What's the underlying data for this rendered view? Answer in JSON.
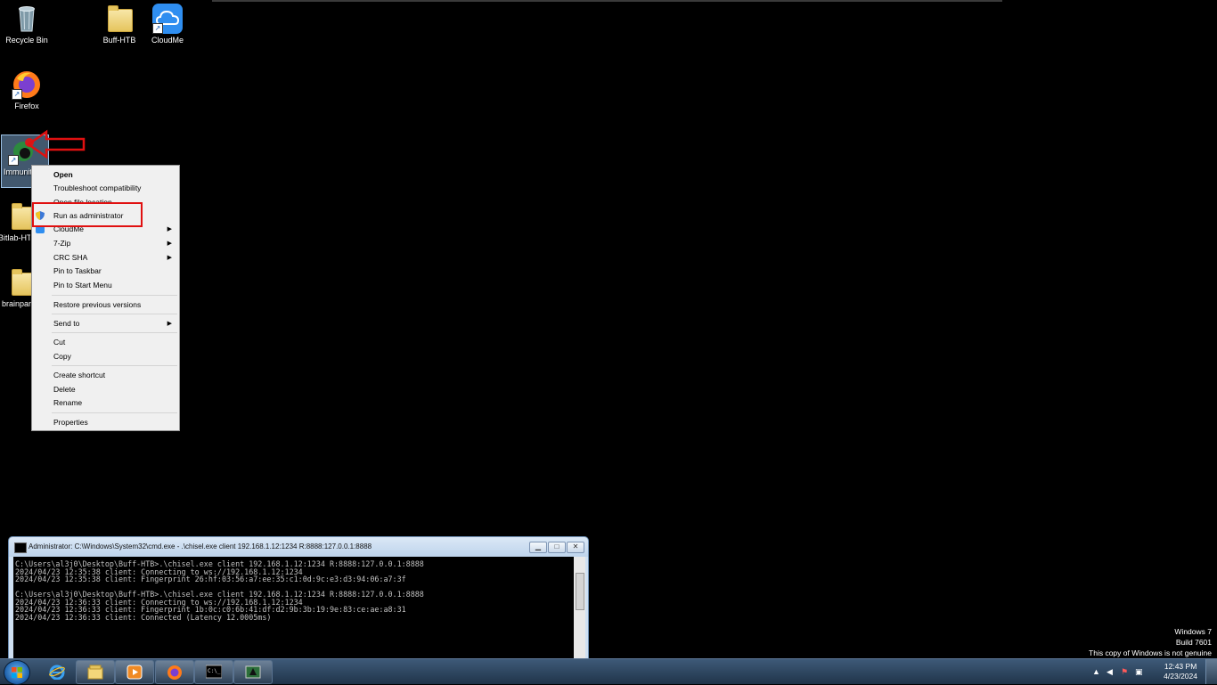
{
  "desktop": {
    "icons": [
      {
        "label": "Recycle Bin"
      },
      {
        "label": "Buff-HTB"
      },
      {
        "label": "CloudMe"
      },
      {
        "label": "Firefox"
      },
      {
        "label": "Immunity Debugger"
      },
      {
        "label": "Bitlab-HTB"
      },
      {
        "label": "brainpan"
      }
    ]
  },
  "context_menu": {
    "items": [
      {
        "label": "Open"
      },
      {
        "label": "Troubleshoot compatibility"
      },
      {
        "label": "Open file location"
      },
      {
        "label": "Run as administrator"
      },
      {
        "label": "CloudMe"
      },
      {
        "label": "7-Zip"
      },
      {
        "label": "CRC SHA"
      },
      {
        "label": "Pin to Taskbar"
      },
      {
        "label": "Pin to Start Menu"
      },
      {
        "label": "Restore previous versions"
      },
      {
        "label": "Send to"
      },
      {
        "label": "Cut"
      },
      {
        "label": "Copy"
      },
      {
        "label": "Create shortcut"
      },
      {
        "label": "Delete"
      },
      {
        "label": "Rename"
      },
      {
        "label": "Properties"
      }
    ]
  },
  "cmd_window": {
    "title": "Administrator: C:\\Windows\\System32\\cmd.exe - .\\chisel.exe  client 192.168.1.12:1234 R:8888:127.0.0.1:8888",
    "lines": [
      "C:\\Users\\al3j0\\Desktop\\Buff-HTB>.\\chisel.exe client 192.168.1.12:1234 R:8888:127.0.0.1:8888",
      "2024/04/23 12:35:38 client: Connecting to ws://192.168.1.12:1234",
      "2024/04/23 12:35:38 client: Fingerprint 26:hf:03:56:a7:ee:35:c1:0d:9c:e3:d3:94:06:a7:3f",
      "",
      "C:\\Users\\al3j0\\Desktop\\Buff-HTB>.\\chisel.exe client 192.168.1.12:1234 R:8888:127.0.0.1:8888",
      "2024/04/23 12:36:33 client: Connecting to ws://192.168.1.12:1234",
      "2024/04/23 12:36:33 client: Fingerprint 1b:0c:c0:6b:41:df:d2:9b:3b:19:9e:83:ce:ae:a8:31",
      "2024/04/23 12:36:33 client: Connected (Latency 12.0005ms)"
    ]
  },
  "watermark": {
    "os": "Windows 7",
    "build": "Build 7601",
    "notice": "This copy of Windows is not genuine"
  },
  "taskbar": {
    "time": "12:43 PM",
    "date": "4/23/2024"
  },
  "colors": {
    "highlight_red": "#e01010",
    "desktop_bg": "#000000",
    "taskbar": "#2a4460"
  }
}
